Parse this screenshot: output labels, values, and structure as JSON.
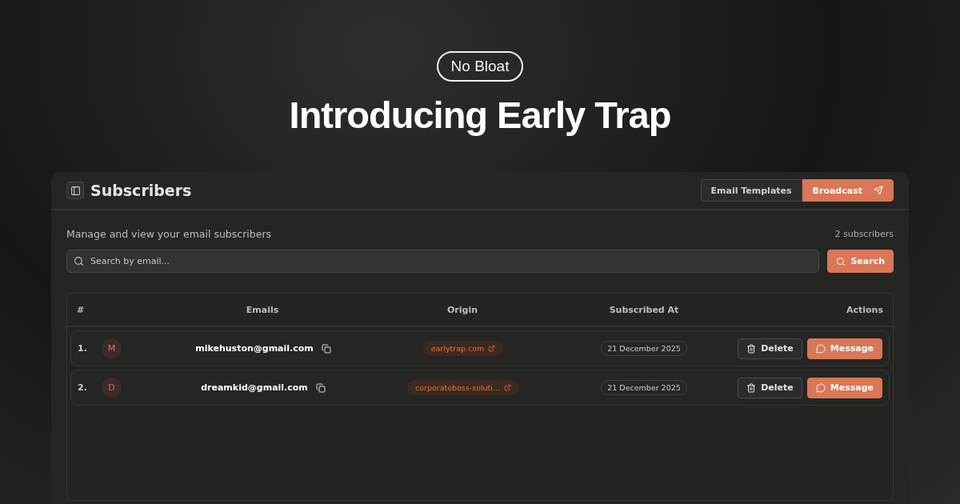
{
  "badge": "No Bloat",
  "headline": "Introducing Early Trap",
  "panel": {
    "title": "Subscribers",
    "tabs": [
      {
        "label": "Email Templates",
        "selected": false
      },
      {
        "label": "Broadcast",
        "selected": true
      }
    ],
    "description": "Manage and view your email subscribers",
    "count": "2 subscribers",
    "search": {
      "placeholder": "Search by email...",
      "button": "Search"
    },
    "table": {
      "columns": [
        "#",
        "Emails",
        "Origin",
        "Subscribed At",
        "Actions"
      ],
      "rows": [
        {
          "index": "1.",
          "initial": "M",
          "email": "mikehuston@gmail.com",
          "origin": "earlytrap.com",
          "date": "21 December 2025",
          "actions": [
            "Delete",
            "Message"
          ]
        },
        {
          "index": "2.",
          "initial": "D",
          "email": "dreamkid@gmail.com",
          "origin": "corporateboss-soluti...",
          "date": "21 December 2025",
          "actions": [
            "Delete",
            "Message"
          ]
        }
      ]
    }
  }
}
